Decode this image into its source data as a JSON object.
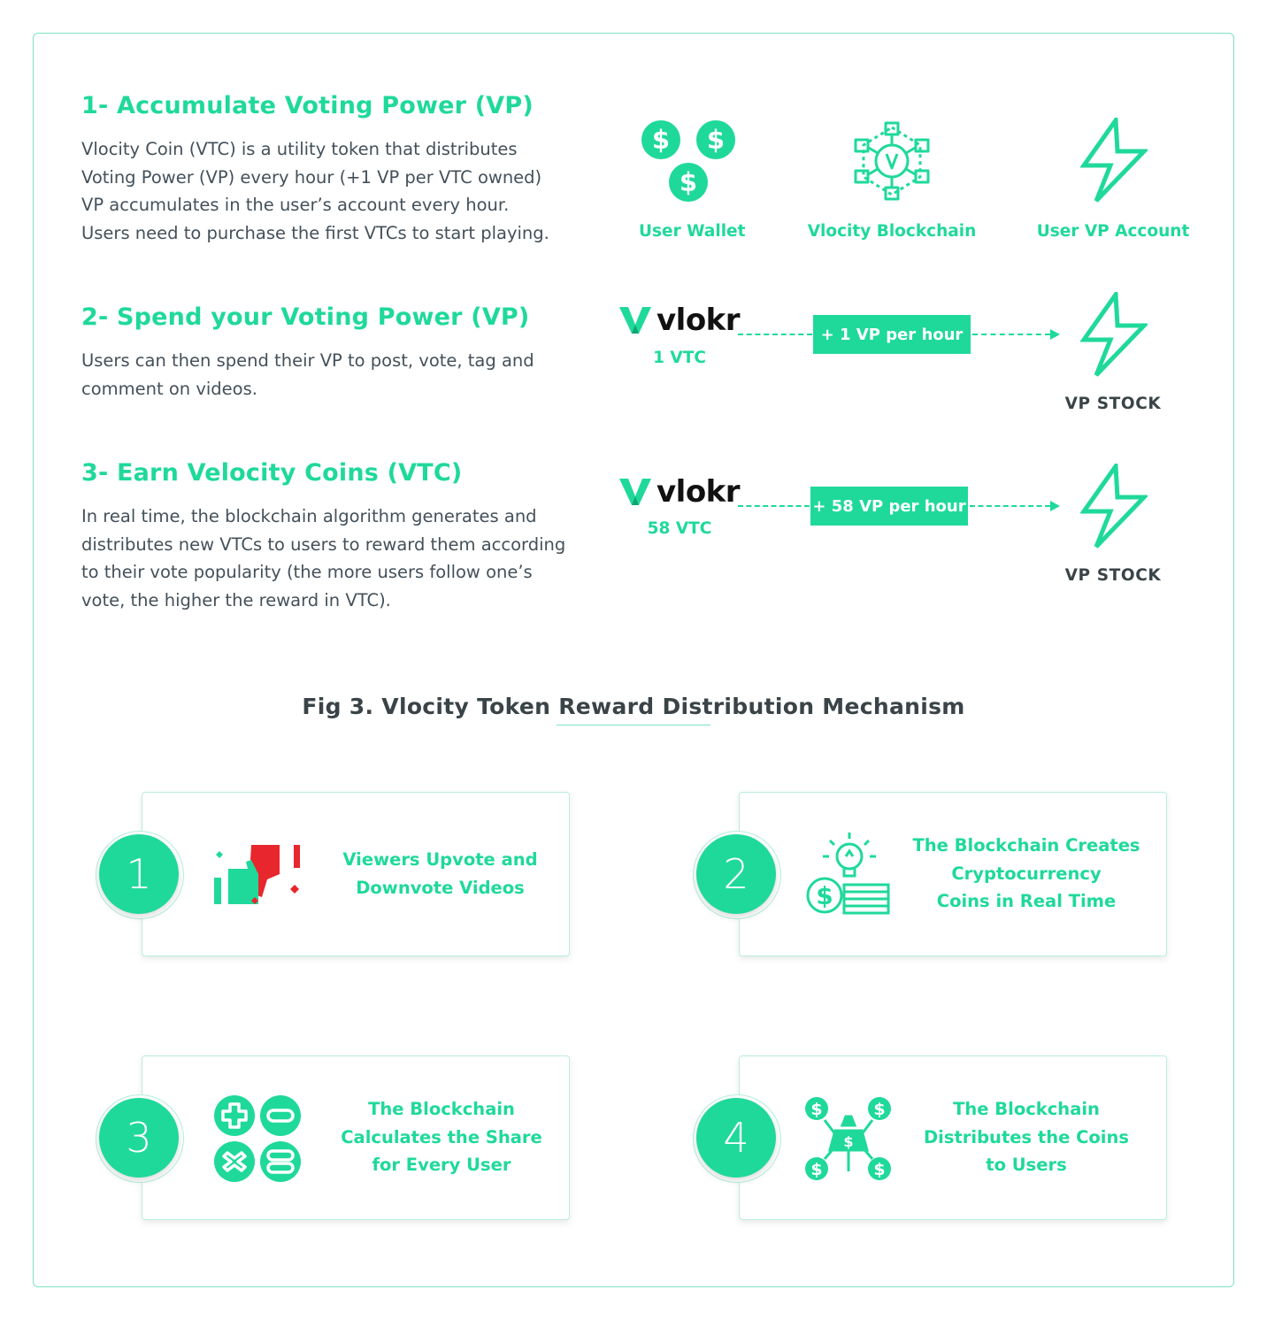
{
  "section1": {
    "title": "1- Accumulate Voting Power (VP)",
    "lines": [
      "Vlocity Coin (VTC) is a utility token that distributes",
      "Voting Power (VP) every hour (+1 VP per VTC owned)",
      "VP accumulates in the user’s account every hour.",
      "Users need to purchase the first VTCs to start playing."
    ],
    "icons": [
      {
        "icon": "dollar-coins-icon",
        "label": "User Wallet"
      },
      {
        "icon": "blockchain-network-icon",
        "label": "Vlocity Blockchain"
      },
      {
        "icon": "lightning-bolt-icon",
        "label": "User VP Account"
      }
    ]
  },
  "section2": {
    "title": "2- Spend your Voting Power (VP)",
    "lines": [
      "Users can then spend their VP to post, vote, tag and",
      "comment on videos."
    ],
    "logo": "vlokr",
    "amount": "1 VTC",
    "rate": "+ 1 VP per hour",
    "stock": "VP STOCK"
  },
  "section3": {
    "title": "3- Earn Velocity Coins (VTC)",
    "lines": [
      "In real time, the blockchain algorithm generates and",
      "distributes new VTCs to users to reward them according",
      "to their vote popularity (the more users follow one’s",
      "vote, the higher the reward in VTC)."
    ],
    "logo": "vlokr",
    "amount": "58 VTC",
    "rate": "+ 58 VP per hour",
    "stock": "VP STOCK"
  },
  "figure_caption": "Fig 3. Vlocity Token Reward Distribution Mechanism",
  "steps": [
    {
      "number": "1",
      "icon": "thumbs-vote-icon",
      "lines": [
        "Viewers Upvote and",
        "Downvote Videos"
      ]
    },
    {
      "number": "2",
      "icon": "idea-coins-icon",
      "lines": [
        "The Blockchain Creates",
        "Cryptocurrency",
        "Coins in Real Time"
      ]
    },
    {
      "number": "3",
      "icon": "calculator-ops-icon",
      "lines": [
        "The Blockchain",
        "Calculates the Share",
        "for Every User"
      ]
    },
    {
      "number": "4",
      "icon": "money-distribution-icon",
      "lines": [
        "The Blockchain",
        "Distributes the Coins",
        "to Users"
      ]
    }
  ],
  "colors": {
    "accent": "#1fd99a",
    "text": "#44505a",
    "heading": "#3a4448",
    "red": "#e8262d"
  }
}
